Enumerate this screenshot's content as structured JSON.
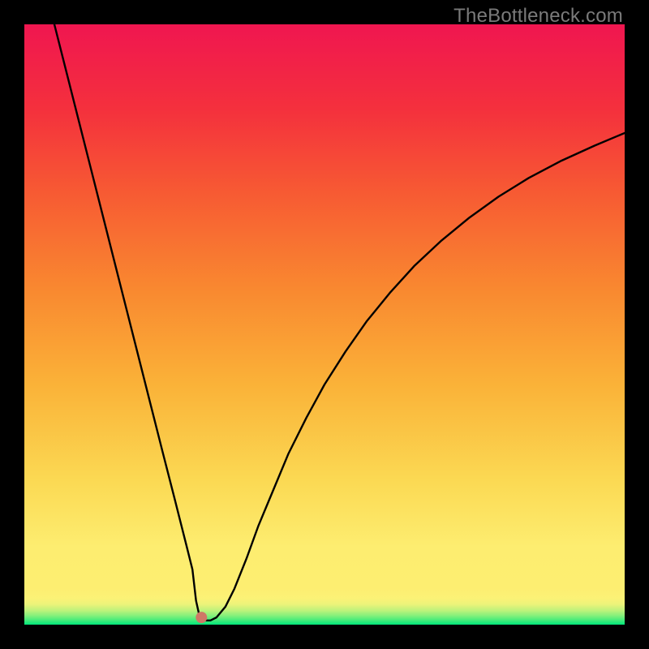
{
  "watermark": "TheBottleneck.com",
  "chart_data": {
    "type": "line",
    "title": "",
    "xlabel": "",
    "ylabel": "",
    "xlim": [
      0,
      100
    ],
    "ylim": [
      0,
      100
    ],
    "grid": false,
    "legend": false,
    "background": {
      "description": "Vertical gradient with thin bright-green band at bottom transitioning through yellow and orange to red/magenta at top",
      "stops": [
        {
          "pos": 0.0,
          "color": "#00e77b"
        },
        {
          "pos": 0.008,
          "color": "#4aec7a"
        },
        {
          "pos": 0.016,
          "color": "#8cf07b"
        },
        {
          "pos": 0.024,
          "color": "#c0f27b"
        },
        {
          "pos": 0.034,
          "color": "#ecf37a"
        },
        {
          "pos": 0.044,
          "color": "#fbf276"
        },
        {
          "pos": 0.06,
          "color": "#fdee71"
        },
        {
          "pos": 0.13,
          "color": "#fded70"
        },
        {
          "pos": 0.24,
          "color": "#fbd953"
        },
        {
          "pos": 0.4,
          "color": "#fab238"
        },
        {
          "pos": 0.56,
          "color": "#f98830"
        },
        {
          "pos": 0.72,
          "color": "#f75a33"
        },
        {
          "pos": 0.86,
          "color": "#f4303d"
        },
        {
          "pos": 1.0,
          "color": "#f01650"
        }
      ]
    },
    "marker": {
      "x": 29.5,
      "y": 1.2,
      "radius_px": 7,
      "color": "#cf7866"
    },
    "series": [
      {
        "name": "curve",
        "color": "#000000",
        "stroke_width_px": 2.4,
        "x": [
          5.0,
          7.0,
          9.0,
          11.0,
          13.0,
          15.0,
          17.0,
          19.0,
          21.0,
          23.0,
          25.0,
          27.0,
          28.0,
          28.6,
          29.2,
          30.2,
          31.0,
          32.0,
          33.5,
          35.0,
          37.0,
          39.0,
          41.5,
          44.0,
          47.0,
          50.0,
          53.5,
          57.0,
          61.0,
          65.0,
          69.5,
          74.0,
          79.0,
          84.0,
          89.5,
          95.0,
          100.0
        ],
        "values": [
          100.0,
          92.1,
          84.2,
          76.3,
          68.4,
          60.5,
          52.6,
          44.7,
          36.8,
          28.9,
          21.1,
          13.2,
          9.2,
          4.0,
          1.3,
          0.7,
          0.7,
          1.2,
          3.0,
          6.0,
          11.0,
          16.5,
          22.5,
          28.5,
          34.5,
          40.0,
          45.5,
          50.5,
          55.4,
          59.8,
          64.0,
          67.7,
          71.3,
          74.4,
          77.3,
          79.8,
          81.9
        ]
      }
    ]
  }
}
